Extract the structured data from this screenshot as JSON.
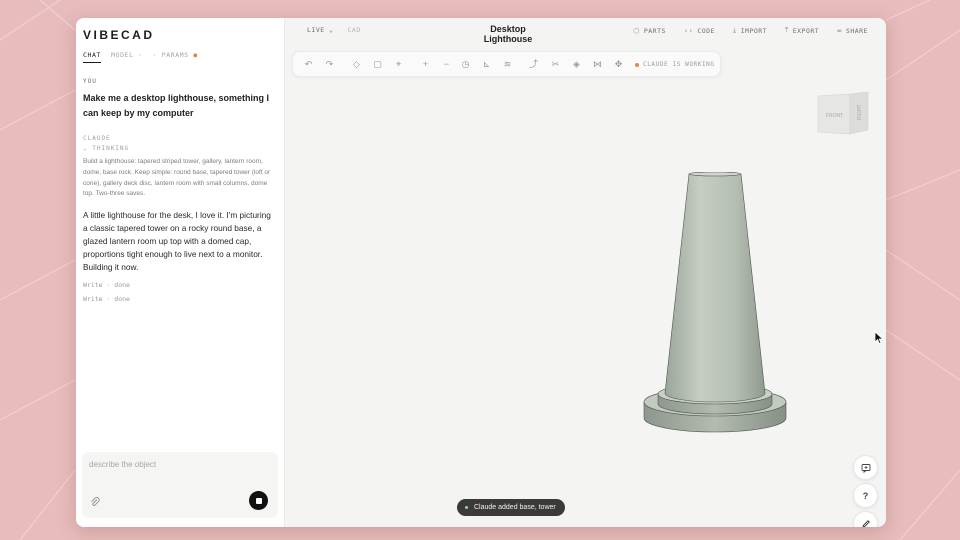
{
  "app": {
    "logo": "VIBECAD",
    "title": "Desktop Lighthouse"
  },
  "sidebar": {
    "tabs": [
      {
        "label": "CHAT"
      },
      {
        "label": "MODEL"
      },
      {
        "label": "PARAMS"
      }
    ],
    "tab_separators": [
      "·",
      "·"
    ],
    "params_dot": "●"
  },
  "chat": {
    "user_role": "YOU",
    "user_message": "Make me a desktop lighthouse, something I can keep by my computer",
    "assistant_role": "CLAUDE",
    "thinking_label": "THINKING",
    "thinking_text": "Build a lighthouse: tapered striped tower, gallery, lantern room, dome, base rock. Keep simple: round base, tapered tower (loft or cone), gallery deck disc, lantern room with small columns, dome top. Two-three saves.",
    "reply": "A little lighthouse for the desk, I love it. I'm picturing a classic tapered tower on a rocky round base, a glazed lantern room up top with a domed cap, proportions tight enough to live next to a monitor. Building it now.",
    "tool_calls": [
      "Write · done",
      "Write · done"
    ],
    "composer_placeholder": "describe the object"
  },
  "header": {
    "live_label": "LIVE",
    "cad_label": "CAD",
    "actions": [
      {
        "label": "PARTS",
        "icon": "cube-icon"
      },
      {
        "label": "CODE",
        "icon": "code-icon"
      },
      {
        "label": "IMPORT",
        "icon": "download-icon"
      },
      {
        "label": "EXPORT",
        "icon": "upload-icon"
      },
      {
        "label": "SHARE",
        "icon": "link-icon"
      }
    ]
  },
  "toolbar": {
    "status": "CLAUDE IS WORKING",
    "status_color": "#e9844a"
  },
  "viewport": {
    "view_cube_faces": [
      "FRONT",
      "RIGHT"
    ],
    "toast": "Claude added base, tower",
    "model_color": "#b9c2b6"
  }
}
